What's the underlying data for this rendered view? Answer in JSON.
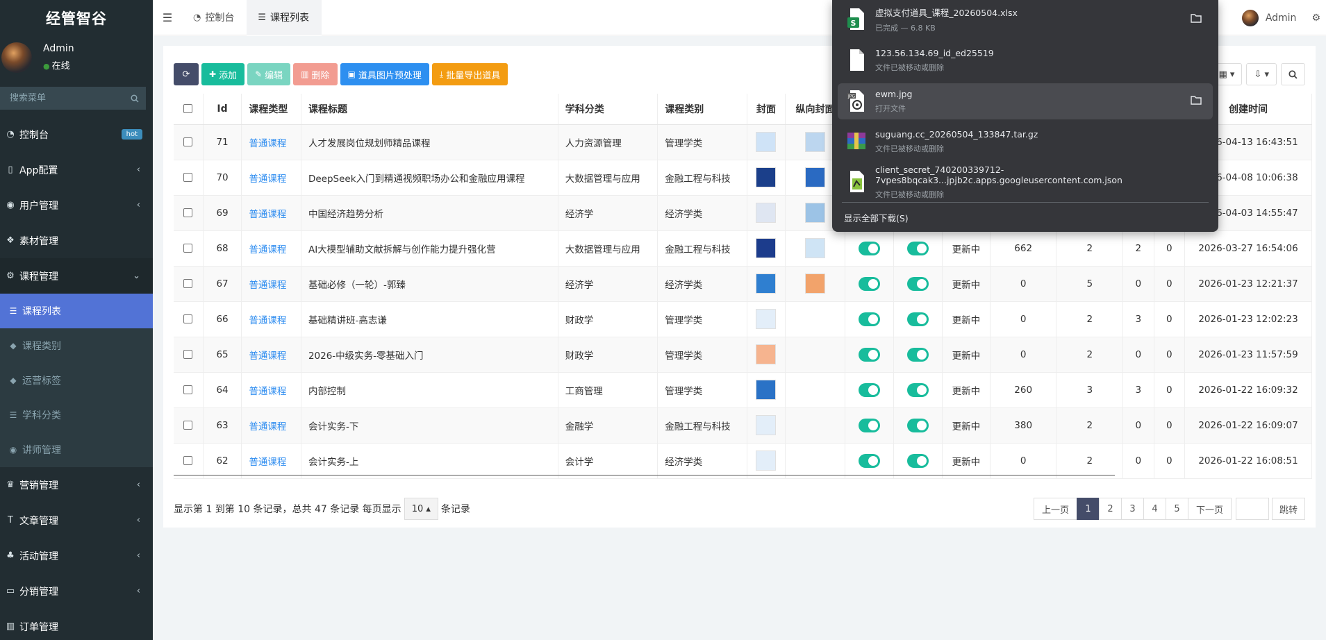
{
  "sidebar": {
    "logo": "经管智谷",
    "user": {
      "name": "Admin",
      "status": "在线"
    },
    "search_placeholder": "搜索菜单",
    "menu": [
      {
        "label": "控制台",
        "icon": "dashboard-icon",
        "badge": "hot"
      },
      {
        "label": "App配置",
        "icon": "mobile-icon"
      },
      {
        "label": "用户管理",
        "icon": "user-icon"
      },
      {
        "label": "素材管理",
        "icon": "cubes-icon"
      },
      {
        "label": "课程管理",
        "icon": "gear-icon"
      }
    ],
    "submenu": [
      {
        "label": "课程列表",
        "icon": "list-icon"
      },
      {
        "label": "课程类别",
        "icon": "tag-icon"
      },
      {
        "label": "运营标签",
        "icon": "tags-icon"
      },
      {
        "label": "学科分类",
        "icon": "list-icon"
      },
      {
        "label": "讲师管理",
        "icon": "user-circle-icon"
      }
    ],
    "menu_bottom": [
      {
        "label": "营销管理",
        "icon": "trophy-icon"
      },
      {
        "label": "文章管理",
        "icon": "text-icon"
      },
      {
        "label": "活动管理",
        "icon": "plant-icon"
      },
      {
        "label": "分销管理",
        "icon": "card-icon"
      },
      {
        "label": "订单管理",
        "icon": "bar-chart-icon"
      }
    ]
  },
  "header": {
    "tabs": [
      {
        "label": "控制台",
        "icon": "dashboard-icon"
      },
      {
        "label": "课程列表",
        "icon": "list-icon"
      }
    ],
    "user": "Admin"
  },
  "toolbar": {
    "add": "添加",
    "edit": "编辑",
    "delete": "删除",
    "image_preprocess": "道具图片预处理",
    "batch_export": "批量导出道具"
  },
  "table": {
    "headers": [
      "Id",
      "课程类型",
      "课程标题",
      "学科分类",
      "课程类别",
      "封面",
      "纵向封面",
      "创建时间"
    ],
    "rows": [
      {
        "id": "71",
        "type": "普通课程",
        "title": "人才发展岗位规划师精品课程",
        "subject": "人力资源管理",
        "category": "管理学类",
        "status": "",
        "n1": "",
        "n2": "",
        "n3": "",
        "n4": "",
        "created": "2026-04-13 16:43:51",
        "cover": "#cfe3f7",
        "vcover": "#bcd6ef",
        "toggles": false
      },
      {
        "id": "70",
        "type": "普通课程",
        "title": "DeepSeek入门到精通视频职场办公和金融应用课程",
        "subject": "大数据管理与应用",
        "category": "金融工程与科技",
        "status": "",
        "n1": "",
        "n2": "",
        "n3": "",
        "n4": "",
        "created": "2026-04-08 10:06:38",
        "cover": "#1b3f8a",
        "vcover": "#2a6ac2",
        "toggles": false
      },
      {
        "id": "69",
        "type": "普通课程",
        "title": "中国经济趋势分析",
        "subject": "经济学",
        "category": "经济学类",
        "status": "",
        "n1": "",
        "n2": "",
        "n3": "",
        "n4": "",
        "created": "2026-04-03 14:55:47",
        "cover": "#dfe6f2",
        "vcover": "#9cc3e6",
        "toggles": false
      },
      {
        "id": "68",
        "type": "普通课程",
        "title": "AI大模型辅助文献拆解与创作能力提升强化营",
        "subject": "大数据管理与应用",
        "category": "金融工程与科技",
        "status": "更新中",
        "n1": "662",
        "n2": "2",
        "n3": "2",
        "n4": "0",
        "created": "2026-03-27 16:54:06",
        "cover": "#1c3c8c",
        "vcover": "#cfe4f5",
        "toggles": true
      },
      {
        "id": "67",
        "type": "普通课程",
        "title": "基础必修（一轮）-郭臻",
        "subject": "经济学",
        "category": "经济学类",
        "status": "更新中",
        "n1": "0",
        "n2": "5",
        "n3": "0",
        "n4": "0",
        "created": "2026-01-23 12:21:37",
        "cover": "#2f7fd0",
        "vcover": "#f2a36b",
        "toggles": true
      },
      {
        "id": "66",
        "type": "普通课程",
        "title": "基础精讲班-高志谦",
        "subject": "财政学",
        "category": "管理学类",
        "status": "更新中",
        "n1": "0",
        "n2": "2",
        "n3": "3",
        "n4": "0",
        "created": "2026-01-23 12:02:23",
        "cover": "#e3eef9",
        "vcover": "",
        "toggles": true
      },
      {
        "id": "65",
        "type": "普通课程",
        "title": "2026-中级实务-零基础入门",
        "subject": "财政学",
        "category": "管理学类",
        "status": "更新中",
        "n1": "0",
        "n2": "2",
        "n3": "0",
        "n4": "0",
        "created": "2026-01-23 11:57:59",
        "cover": "#f6b48f",
        "vcover": "",
        "toggles": true
      },
      {
        "id": "64",
        "type": "普通课程",
        "title": "内部控制",
        "subject": "工商管理",
        "category": "管理学类",
        "status": "更新中",
        "n1": "260",
        "n2": "3",
        "n3": "3",
        "n4": "0",
        "created": "2026-01-22 16:09:32",
        "cover": "#2a72c6",
        "vcover": "",
        "toggles": true
      },
      {
        "id": "63",
        "type": "普通课程",
        "title": "会计实务-下",
        "subject": "金融学",
        "category": "金融工程与科技",
        "status": "更新中",
        "n1": "380",
        "n2": "2",
        "n3": "0",
        "n4": "0",
        "created": "2026-01-22 16:09:07",
        "cover": "#e3eef9",
        "vcover": "",
        "toggles": true
      },
      {
        "id": "62",
        "type": "普通课程",
        "title": "会计实务-上",
        "subject": "会计学",
        "category": "经济学类",
        "status": "更新中",
        "n1": "0",
        "n2": "2",
        "n3": "0",
        "n4": "0",
        "created": "2026-01-22 16:08:51",
        "cover": "#e3eef9",
        "vcover": "",
        "toggles": true
      }
    ]
  },
  "pagination": {
    "info_prefix": "显示第 1 到第 10 条记录，总共 47 条记录 每页显示",
    "page_size": "10",
    "info_suffix": "条记录",
    "prev": "上一页",
    "pages": [
      "1",
      "2",
      "3",
      "4",
      "5"
    ],
    "active_page": "1",
    "next": "下一页",
    "go": "跳转"
  },
  "downloads": {
    "items": [
      {
        "name": "虚拟支付道具_课程_20260504.xlsx",
        "status": "已完成 — 6.8 KB",
        "icon": "spreadsheet-file-icon"
      },
      {
        "name": "123.56.134.69_id_ed25519",
        "status": "文件已被移动或删除",
        "icon": "blank-file-icon"
      },
      {
        "name": "ewm.jpg",
        "status": "打开文件",
        "icon": "image-file-icon"
      },
      {
        "name": "suguang.cc_20260504_133847.tar.gz",
        "status": "文件已被移动或删除",
        "icon": "archive-file-icon"
      },
      {
        "name": "client_secret_740200339712-7vpes8bqcak3...jpjb2c.apps.googleusercontent.com.json",
        "status": "文件已被移动或删除",
        "icon": "json-file-icon"
      }
    ],
    "show_all": "显示全部下载(S)"
  },
  "colors": {
    "sidebar_bg": "#222d32",
    "active_menu": "#5273d6",
    "link": "#2d8cf0",
    "toggle_on": "#18bc9c",
    "btn_add": "#18bc9c",
    "btn_image": "#2d8ff0",
    "btn_export": "#f39c12"
  }
}
